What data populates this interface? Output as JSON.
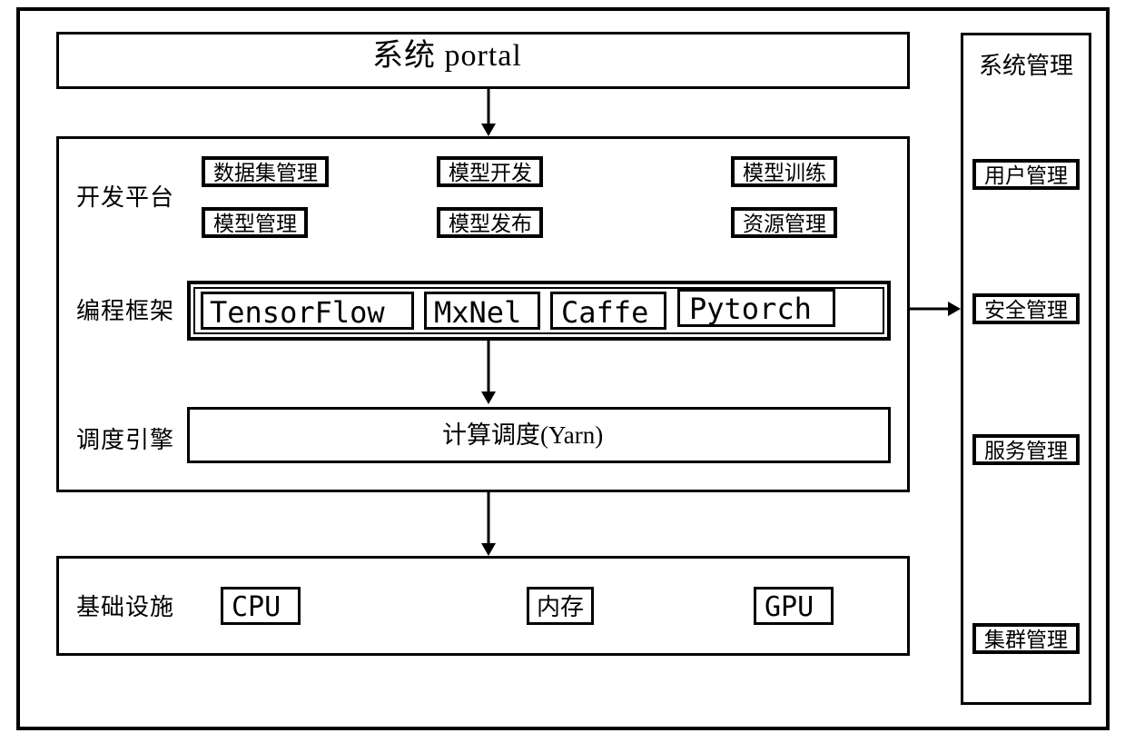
{
  "portal": {
    "title": "系统 portal"
  },
  "platform": {
    "label": "开发平台",
    "row1": {
      "a": "数据集管理",
      "b": "模型开发",
      "c": "模型训练"
    },
    "row2": {
      "a": "模型管理",
      "b": "模型发布",
      "c": "资源管理"
    }
  },
  "frameworks": {
    "label": "编程框架",
    "items": {
      "a": "TensorFlow",
      "b": "MxNel",
      "c": "Caffe",
      "d": "Pytorch"
    }
  },
  "scheduler": {
    "label": "调度引擎",
    "box_label": "计算调度(Yarn)"
  },
  "infra": {
    "label": "基础设施",
    "items": {
      "a": "CPU",
      "b": "内存",
      "c": "GPU"
    }
  },
  "mgmt": {
    "title": "系统管理",
    "items": {
      "a": "用户管理",
      "b": "安全管理",
      "c": "服务管理",
      "d": "集群管理"
    }
  }
}
